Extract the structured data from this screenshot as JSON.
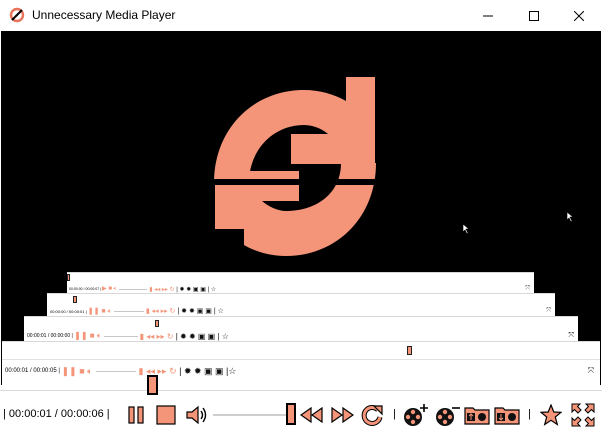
{
  "window": {
    "title": "Unnecessary Media Player"
  },
  "colors": {
    "accent": "#f4957a",
    "video_bg": "#000000",
    "outline": "#000000"
  },
  "icons": {
    "app": "reload-icon",
    "minimize": "minimize-icon",
    "maximize": "maximize-icon",
    "close": "close-icon",
    "video_overlay": "reload-icon"
  },
  "nested_players": [
    {
      "time": "00:00:00 / 00:00:07"
    },
    {
      "time": "00:00:00 / 00:00:01"
    },
    {
      "time": "00:00:01 / 00:00:00"
    },
    {
      "time": "00:00:01 / 00:00:05"
    }
  ],
  "player": {
    "time_display": "00:00:01 / 00:00:06",
    "separator": "|",
    "seek_fraction": 0.17,
    "volume_fraction": 1.0
  },
  "controls": [
    {
      "icon": "pause-icon"
    },
    {
      "icon": "stop-icon"
    },
    {
      "icon": "volume-icon"
    },
    {
      "icon": "rewind-icon"
    },
    {
      "icon": "fast-forward-icon"
    },
    {
      "icon": "reload-icon"
    },
    {
      "icon": "add-film-icon"
    },
    {
      "icon": "remove-film-icon"
    },
    {
      "icon": "open-folder-film-icon"
    },
    {
      "icon": "save-folder-film-icon"
    },
    {
      "icon": "favorite-star-icon"
    },
    {
      "icon": "fullscreen-icon"
    }
  ]
}
